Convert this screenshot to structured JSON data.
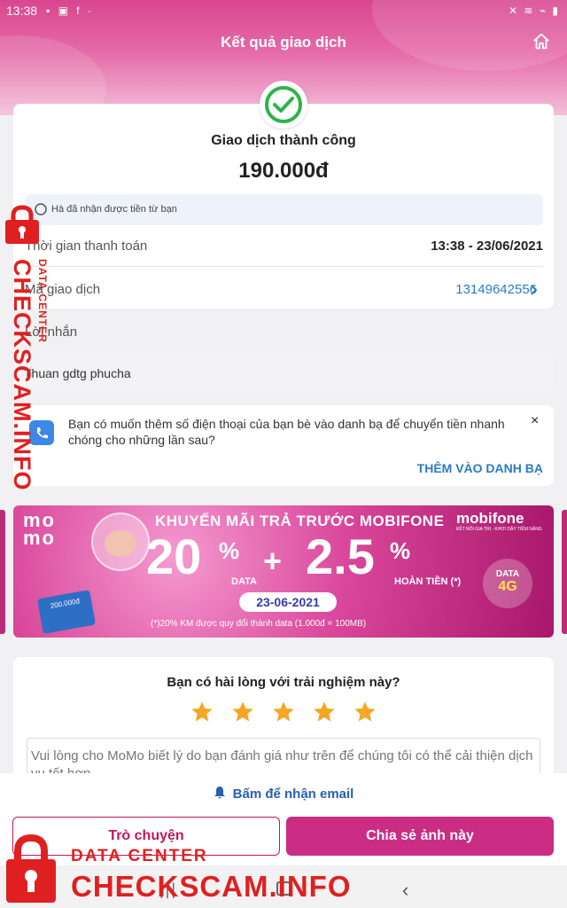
{
  "status_bar": {
    "time": "13:38",
    "left_icons": "▪ ▣ f ·",
    "right_icons": "✕ ≋ ⌁ ▮"
  },
  "header": {
    "title": "Kết quả giao dịch",
    "home_icon": "home-icon"
  },
  "result": {
    "status": "Giao dịch thành công",
    "amount": "190.000đ",
    "note": "Hà đã nhận được tiền từ bạn",
    "rows": {
      "time_label": "Thời gian thanh toán",
      "time_value": "13:38 - 23/06/2021",
      "code_label": "Mã giao dịch",
      "code_value": "13149642556"
    }
  },
  "message": {
    "label": "Lời nhắn",
    "text": "Thuan gdtg phucha"
  },
  "contact_prompt": {
    "text": "Bạn có muốn thêm số điện thoại của bạn bè vào danh bạ để chuyển tiền nhanh chóng cho những lần sau?",
    "close": "×",
    "action": "THÊM VÀO DANH BẠ"
  },
  "banner": {
    "brand": "mo\nmo",
    "brand_line1": "mo",
    "brand_line2": "mo",
    "partner": "mobifone",
    "partner_sub": "KẾT NỐI GIA TRỊ - KHƠI DẬY TIỀM NĂNG",
    "title": "KHUYẾN MÃI TRẢ TRƯỚC MOBIFONE",
    "big1": "20",
    "big2": "2.5",
    "pct": "%",
    "plus": "+",
    "data_label": "DATA",
    "cashback_label": "HOÀN TIỀN (*)",
    "date": "23-06-2021",
    "note": "(*)20% KM được quy đổi thành data (1.000đ = 100MB)",
    "badge_top": "DATA",
    "badge_bottom": "4G",
    "sim_label": "200.000đ"
  },
  "rating": {
    "question": "Bạn có hài lòng với trải nghiệm này?",
    "stars": 5,
    "star_color": "#f5a623",
    "placeholder": "Vui lòng cho MoMo biết lý do bạn đánh giá như trên để chúng tôi có thể cải thiện dịch vụ tốt hơn"
  },
  "email": {
    "label": "Bấm để nhận email"
  },
  "buttons": {
    "chat": "Trò chuyện",
    "share": "Chia sẻ ảnh này"
  },
  "watermark": {
    "small": "DATA CENTER",
    "big": "CHECKSCAM.INFO"
  },
  "colors": {
    "brand": "#cb2c84",
    "link": "#2a7bc4",
    "success": "#2fb24b",
    "watermark": "#e02020"
  }
}
